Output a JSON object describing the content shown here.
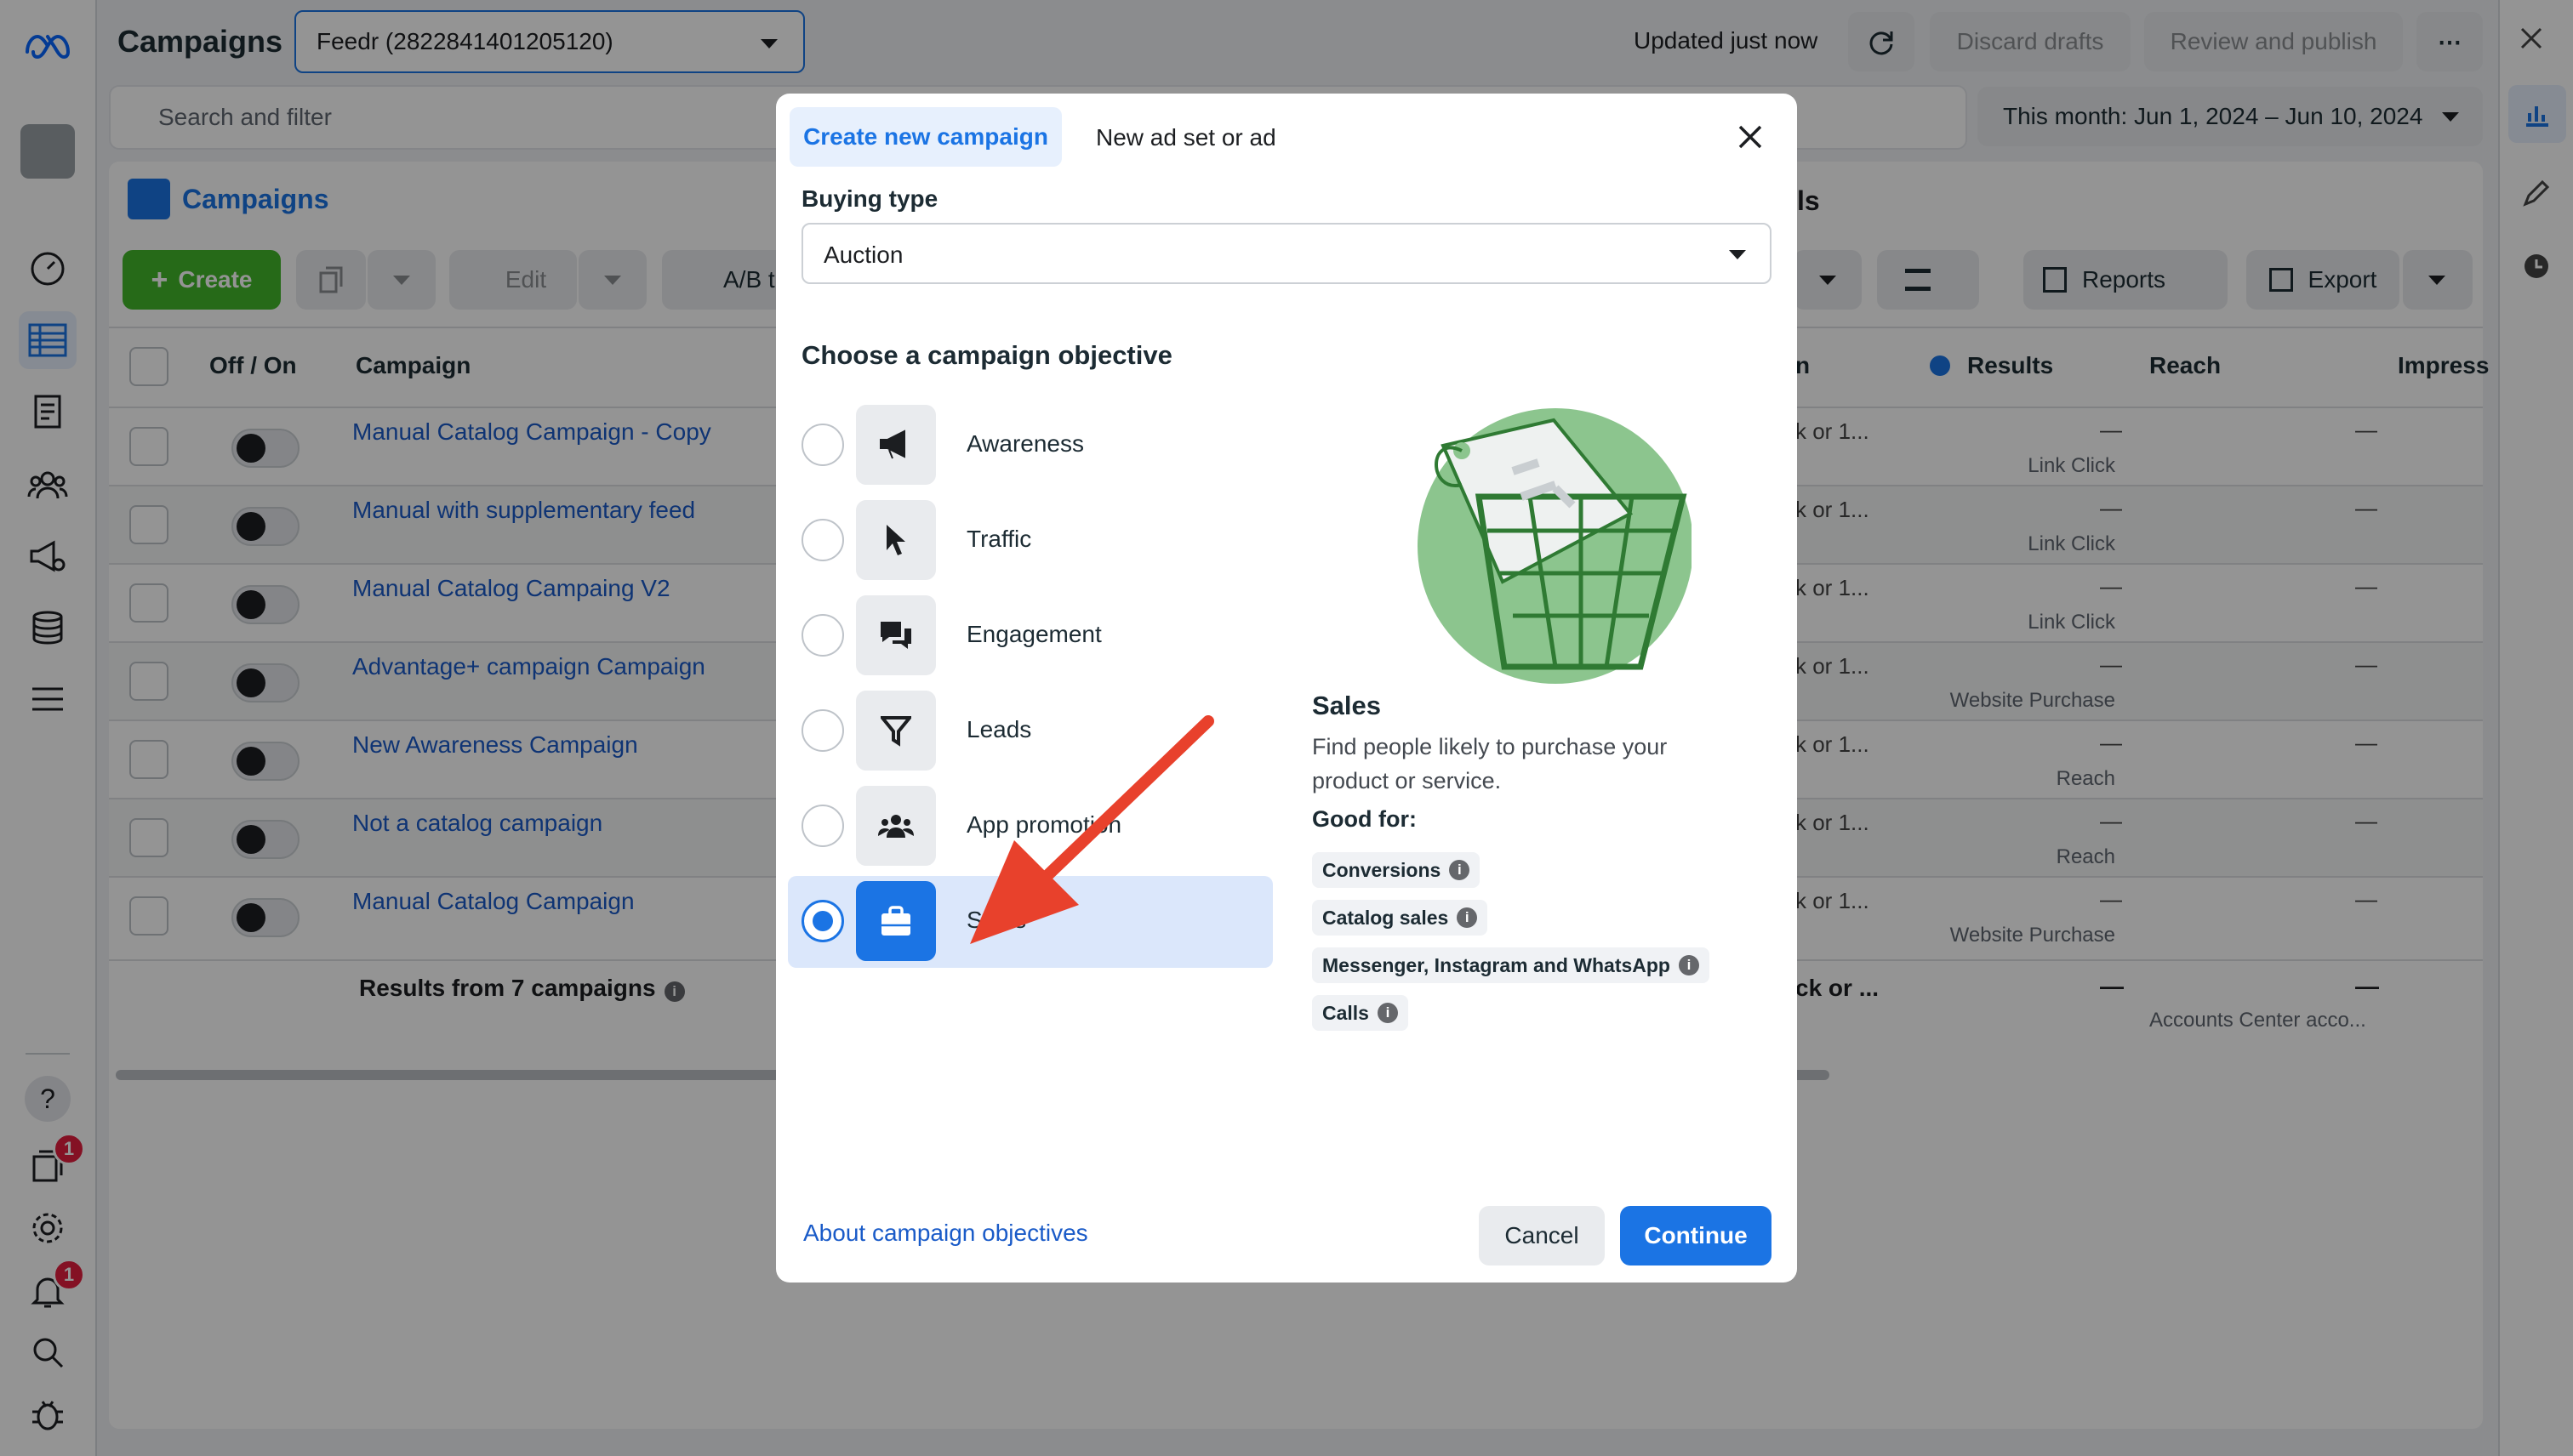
{
  "header": {
    "title": "Campaigns",
    "account_selector": "Feedr (2822841401205120)",
    "updated": "Updated just now",
    "discard": "Discard drafts",
    "review": "Review and publish",
    "more": "⋯"
  },
  "search": {
    "placeholder": "Search and filter"
  },
  "date_range": "This month: Jun 1, 2024 – Jun 10, 2024",
  "tabs": {
    "campaigns": "Campaigns",
    "ads_partial": "ls"
  },
  "toolbar": {
    "create": "Create",
    "edit": "Edit",
    "ab_test": "A/B t",
    "reports": "Reports",
    "export": "Export"
  },
  "table": {
    "headers": {
      "off_on": "Off / On",
      "campaign": "Campaign",
      "partial": "n",
      "results": "Results",
      "reach": "Reach",
      "impressions": "Impress"
    },
    "rows": [
      {
        "name": "Manual Catalog Campaign - Copy",
        "partial": "k or 1...",
        "results": "—",
        "results_sub": "Link Click",
        "reach": "—"
      },
      {
        "name": "Manual with supplementary feed",
        "partial": "k or 1...",
        "results": "—",
        "results_sub": "Link Click",
        "reach": "—"
      },
      {
        "name": "Manual Catalog Campaing V2",
        "partial": "k or 1...",
        "results": "—",
        "results_sub": "Link Click",
        "reach": "—"
      },
      {
        "name": "Advantage+ campaign Campaign",
        "partial": "k or 1...",
        "results": "—",
        "results_sub": "Website Purchase",
        "reach": "—"
      },
      {
        "name": "New Awareness Campaign",
        "partial": "k or 1...",
        "results": "—",
        "results_sub": "Reach",
        "reach": "—"
      },
      {
        "name": "Not a catalog campaign",
        "partial": "k or 1...",
        "results": "—",
        "results_sub": "Reach",
        "reach": "—"
      },
      {
        "name": "Manual Catalog Campaign",
        "partial": "k or 1...",
        "results": "—",
        "results_sub": "Website Purchase",
        "reach": "—"
      }
    ],
    "summary": {
      "label": "Results from 7 campaigns",
      "partial": "ck or ...",
      "results": "—",
      "reach": "—",
      "reach_sub": "Accounts Center acco..."
    }
  },
  "nav_badges": {
    "ads_reporting": "1",
    "notifications": "1"
  },
  "modal": {
    "tab_create": "Create new campaign",
    "tab_new": "New ad set or ad",
    "buying_type_label": "Buying type",
    "buying_type_value": "Auction",
    "objective_heading": "Choose a campaign objective",
    "objectives": [
      {
        "label": "Awareness",
        "icon": "megaphone-icon"
      },
      {
        "label": "Traffic",
        "icon": "cursor-icon"
      },
      {
        "label": "Engagement",
        "icon": "chat-bubbles-icon"
      },
      {
        "label": "Leads",
        "icon": "funnel-icon"
      },
      {
        "label": "App promotion",
        "icon": "people-icon"
      },
      {
        "label": "Sales",
        "icon": "shopping-bag-icon",
        "selected": true
      }
    ],
    "detail": {
      "title": "Sales",
      "desc": "Find people likely to purchase your product or service.",
      "good_for": "Good for:",
      "chips": [
        "Conversions",
        "Catalog sales",
        "Messenger, Instagram and WhatsApp",
        "Calls"
      ]
    },
    "about_link": "About campaign objectives",
    "cancel": "Cancel",
    "continue": "Continue"
  },
  "colors": {
    "accent": "#1b74e4",
    "create_green": "#42b72a",
    "arrow_red": "#e8412c",
    "illustration_green": "#8cc58e"
  }
}
